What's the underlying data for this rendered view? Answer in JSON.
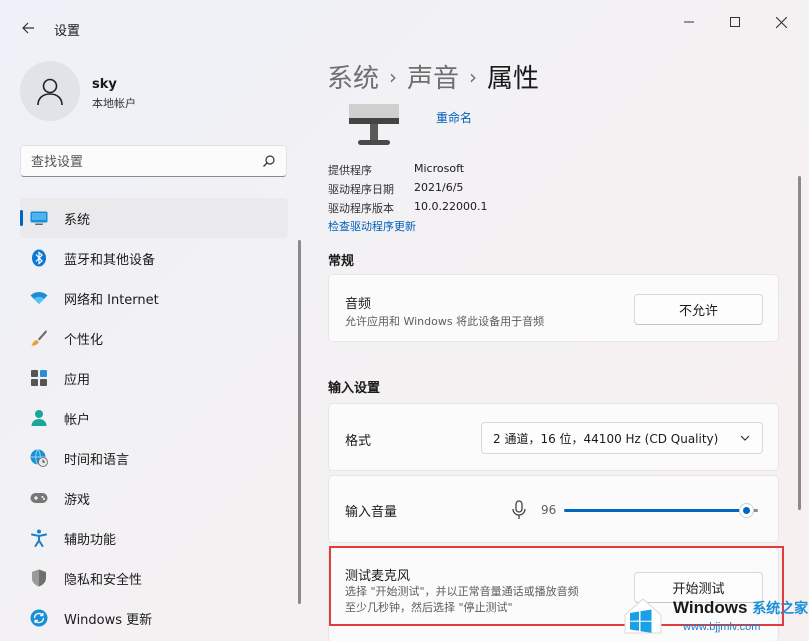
{
  "window": {
    "app_title": "设置",
    "controls": {
      "minimize": "—",
      "maximize": "☐",
      "close": "✕"
    }
  },
  "profile": {
    "name": "sky",
    "account_type": "本地帐户"
  },
  "search": {
    "placeholder": "查找设置"
  },
  "sidebar": {
    "items": [
      {
        "label": "系统",
        "icon": "monitor-icon",
        "active": true
      },
      {
        "label": "蓝牙和其他设备",
        "icon": "bluetooth-icon"
      },
      {
        "label": "网络和 Internet",
        "icon": "wifi-icon"
      },
      {
        "label": "个性化",
        "icon": "brush-icon"
      },
      {
        "label": "应用",
        "icon": "apps-icon"
      },
      {
        "label": "帐户",
        "icon": "person-icon"
      },
      {
        "label": "时间和语言",
        "icon": "globe-clock-icon"
      },
      {
        "label": "游戏",
        "icon": "gamepad-icon"
      },
      {
        "label": "辅助功能",
        "icon": "accessibility-icon"
      },
      {
        "label": "隐私和安全性",
        "icon": "shield-icon"
      },
      {
        "label": "Windows 更新",
        "icon": "update-icon"
      }
    ]
  },
  "breadcrumb": {
    "level1": "系统",
    "level2": "声音",
    "current": "属性",
    "separator": "›"
  },
  "device": {
    "rename": "重命名",
    "properties": [
      {
        "label": "提供程序",
        "value": "Microsoft"
      },
      {
        "label": "驱动程序日期",
        "value": "2021/6/5"
      },
      {
        "label": "驱动程序版本",
        "value": "10.0.22000.1"
      }
    ],
    "check_driver_link": "检查驱动程序更新"
  },
  "general": {
    "section_title": "常规",
    "audio": {
      "title": "音频",
      "description": "允许应用和 Windows 将此设备用于音频",
      "button": "不允许"
    }
  },
  "input_settings": {
    "section_title": "输入设置",
    "format": {
      "label": "格式",
      "value": "2 通道，16 位，44100 Hz (CD Quality)"
    },
    "volume": {
      "label": "输入音量",
      "value": "96",
      "level": 0.96
    },
    "test_mic": {
      "title": "测试麦克风",
      "description_line1": "选择 \"开始测试\"，并以正常音量通话或播放音频",
      "description_line2": "至少几秒钟，然后选择 \"停止测试\"",
      "button": "开始测试"
    }
  },
  "watermark": {
    "brand": "Windows",
    "brand_cn": "系统之家",
    "url": "www.bjjmlv.com"
  },
  "colors": {
    "accent": "#0067c0",
    "link": "#0060b8",
    "highlight": "#e03c3c"
  }
}
